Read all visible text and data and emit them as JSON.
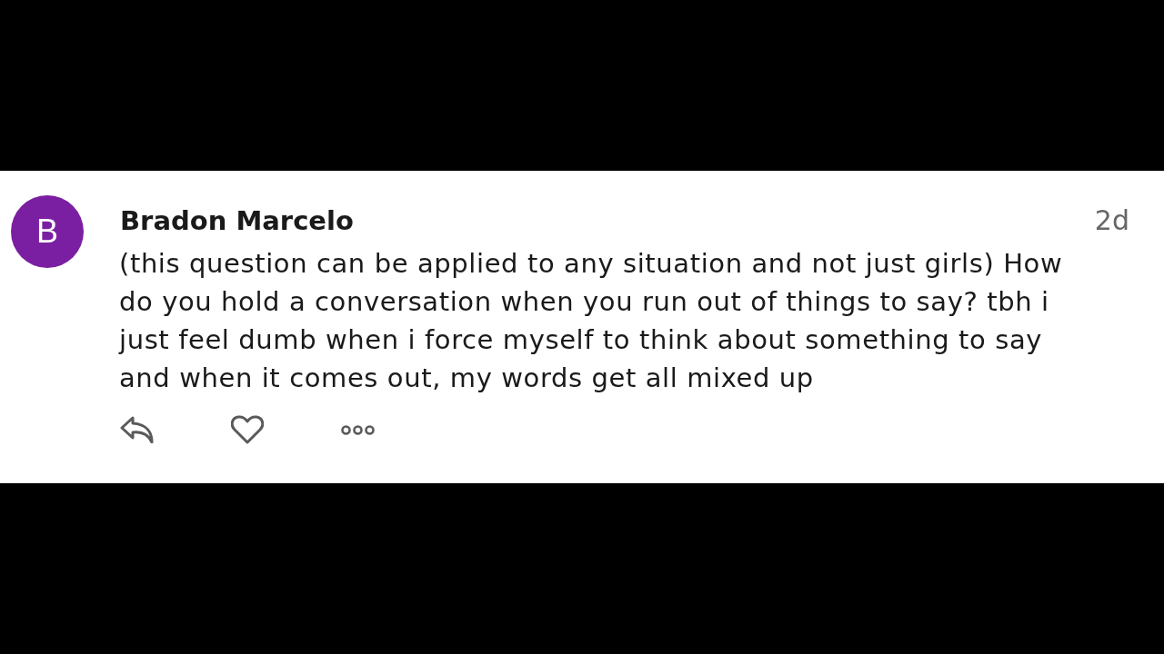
{
  "comment": {
    "avatar": {
      "letter": "B"
    },
    "author": "Bradon Marcelo",
    "time": "2d",
    "text": "(this question can be applied to any situation and not just girls) How do you hold a conversation when you run out of things to say? tbh i just feel dumb when i force myself to think about something to say and when it comes out, my words get all mixed up"
  }
}
